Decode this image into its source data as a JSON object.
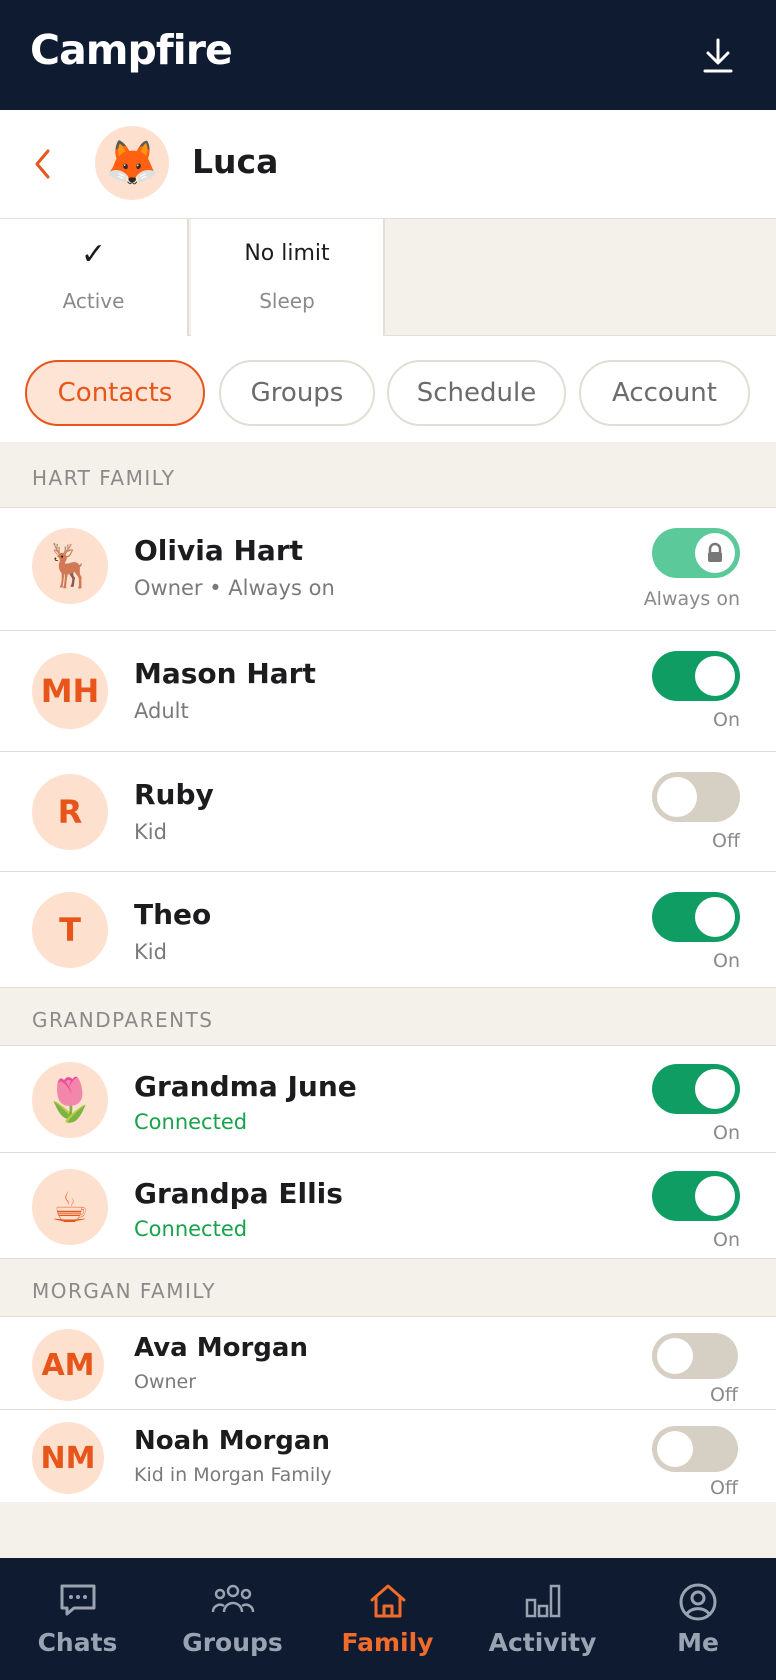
{
  "app": {
    "brand": "Campfire"
  },
  "profile": {
    "name": "Luca",
    "avatar_icon": "fox-emoji",
    "avatar_glyph": "🦊"
  },
  "status": [
    {
      "value": "✓",
      "label": "Active"
    },
    {
      "value": "No limit",
      "label": "Sleep"
    }
  ],
  "tabs": [
    {
      "label": "Contacts",
      "active": true
    },
    {
      "label": "Groups",
      "active": false
    },
    {
      "label": "Schedule",
      "active": false
    },
    {
      "label": "Account",
      "active": false
    }
  ],
  "sections": [
    {
      "title": "HART FAMILY",
      "contacts": [
        {
          "name": "Olivia Hart",
          "subtitle": "Owner • Always on",
          "avatar": "🦌",
          "avatar_icon": "deer-emoji",
          "toggle": "locked",
          "state_label": "Always on"
        },
        {
          "name": "Mason Hart",
          "subtitle": "Adult",
          "avatar": "MH",
          "toggle": "on",
          "state_label": "On"
        },
        {
          "name": "Ruby",
          "subtitle": "Kid",
          "avatar": "R",
          "toggle": "off",
          "state_label": "Off"
        },
        {
          "name": "Theo",
          "subtitle": "Kid",
          "avatar": "T",
          "toggle": "on",
          "state_label": "On"
        }
      ]
    },
    {
      "title": "GRANDPARENTS",
      "contacts": [
        {
          "name": "Grandma June",
          "subtitle": "Connected",
          "avatar": "🌷",
          "avatar_icon": "flower-emoji",
          "toggle": "on",
          "state_label": "On"
        },
        {
          "name": "Grandpa Ellis",
          "subtitle": "Connected",
          "avatar": "☕",
          "avatar_icon": "mug-emoji",
          "toggle": "on",
          "state_label": "On"
        }
      ]
    },
    {
      "title": "MORGAN FAMILY",
      "contacts": [
        {
          "name": "Ava Morgan",
          "subtitle": "Owner",
          "avatar": "AM",
          "toggle": "off",
          "state_label": "Off"
        },
        {
          "name": "Noah Morgan",
          "subtitle": "Kid in Morgan Family",
          "avatar": "NM",
          "toggle": "off",
          "state_label": "Off"
        }
      ]
    }
  ],
  "nav": [
    {
      "label": "Chats",
      "icon": "chat-icon",
      "active": false
    },
    {
      "label": "Groups",
      "icon": "groups-icon",
      "active": false
    },
    {
      "label": "Family",
      "icon": "home-icon",
      "active": true
    },
    {
      "label": "Activity",
      "icon": "bar-chart-icon",
      "active": false
    },
    {
      "label": "Me",
      "icon": "user-circle-icon",
      "active": false
    }
  ],
  "colors": {
    "header_bg": "#0f1b31",
    "accent": "#e8551a",
    "toggle_on": "#0f9d63",
    "toggle_locked": "#5cc99a",
    "toggle_off": "#d6cfc3",
    "connected_green": "#16a34a"
  }
}
